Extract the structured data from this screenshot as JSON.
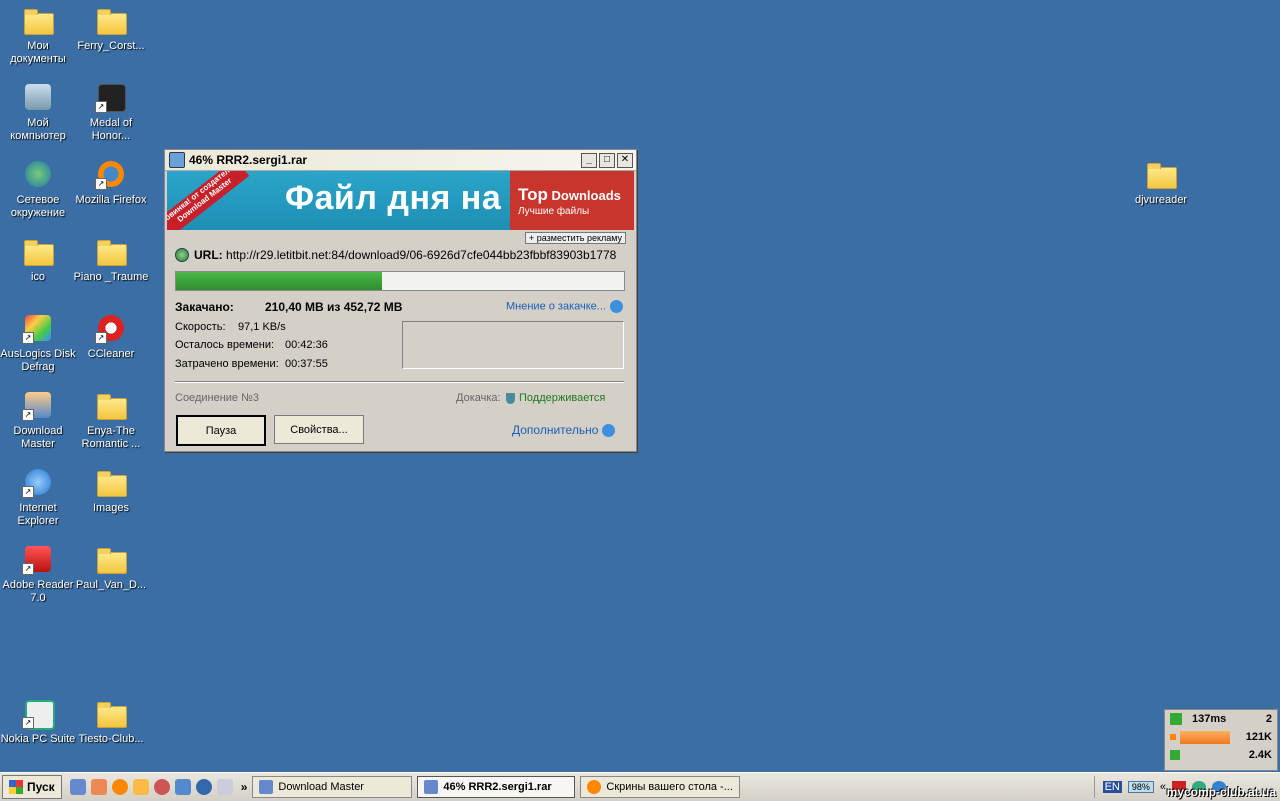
{
  "desktop": {
    "icons_left": [
      {
        "label": "Мои\nдокументы",
        "icon": "my-documents-icon"
      },
      {
        "label": "Мой\nкомпьютер",
        "icon": "my-computer-icon"
      },
      {
        "label": "Сетевое\nокружение",
        "icon": "network-icon"
      },
      {
        "label": "ico",
        "icon": "folder-icon"
      },
      {
        "label": "AusLogics Disk\nDefrag",
        "icon": "defrag-icon"
      },
      {
        "label": "Download\nMaster",
        "icon": "download-master-icon"
      },
      {
        "label": "Internet\nExplorer",
        "icon": "ie-icon"
      },
      {
        "label": "Adobe Reader\n7.0",
        "icon": "adobe-reader-icon"
      },
      {
        "label": "Nokia PC Suite",
        "icon": "nokia-icon"
      }
    ],
    "icons_second": [
      {
        "label": "Ferry_Corst...",
        "icon": "folder-icon"
      },
      {
        "label": "Medal of\nHonor...",
        "icon": "medal-of-honor-icon"
      },
      {
        "label": "Mozilla Firefox",
        "icon": "firefox-icon"
      },
      {
        "label": "Piano _Traume",
        "icon": "folder-icon"
      },
      {
        "label": "CCleaner",
        "icon": "ccleaner-icon"
      },
      {
        "label": "Enya-The\nRomantic ...",
        "icon": "folder-icon"
      },
      {
        "label": "Images",
        "icon": "folder-icon"
      },
      {
        "label": "Paul_Van_D...",
        "icon": "folder-icon"
      },
      {
        "label": "Tiesto-Club...",
        "icon": "folder-icon"
      }
    ],
    "icon_right": {
      "label": "djvureader",
      "icon": "folder-icon"
    }
  },
  "window": {
    "title": "46% RRR2.sergi1.rar",
    "banner": {
      "ribbon": "новинка! от создателей Download Master",
      "headline": "Файл дня на",
      "brand_top": "Top",
      "brand_downloads": "Downloads",
      "brand_sub": "Лучшие файлы",
      "ad_button": "+ разместить рекламу"
    },
    "url_label": "URL:",
    "url": "http://r29.letitbit.net:84/download9/06-6926d7cfe044bb23fbbf83903b1778",
    "progress_percent": 46,
    "downloaded_label": "Закачано:",
    "downloaded_value": "210,40 MB из 452,72 MB",
    "opinion_link": "Мнение о закачке...",
    "speed_label": "Скорость:",
    "speed_value": "97,1 KB/s",
    "remaining_label": "Осталось времени:",
    "remaining_value": "00:42:36",
    "elapsed_label": "Затрачено времени:",
    "elapsed_value": "00:37:55",
    "connection": "Соединение №3",
    "resume_label": "Докачка:",
    "resume_value": "Поддерживается",
    "pause_button": "Пауза",
    "properties_button": "Свойства...",
    "more_link": "Дополнительно"
  },
  "net_widget": {
    "ping": "137ms",
    "count": "2",
    "download": "121K",
    "upload": "2.4K"
  },
  "taskbar": {
    "start_label": "Пуск",
    "chevron": "»",
    "tasks": [
      {
        "label": "Download Master",
        "active": false
      },
      {
        "label": "46% RRR2.sergi1.rar",
        "active": true
      },
      {
        "label": "Скрины вашего стола -...",
        "active": false
      }
    ],
    "lang": "EN",
    "battery": "98%",
    "tray_chevron": "«",
    "watermark": "mycomp-club.at.ua"
  },
  "colors": {
    "desktop": "#3a6ea5",
    "progress": "#2e8d2e",
    "banner_left": "#1e8fb4",
    "banner_right": "#c8352c"
  }
}
